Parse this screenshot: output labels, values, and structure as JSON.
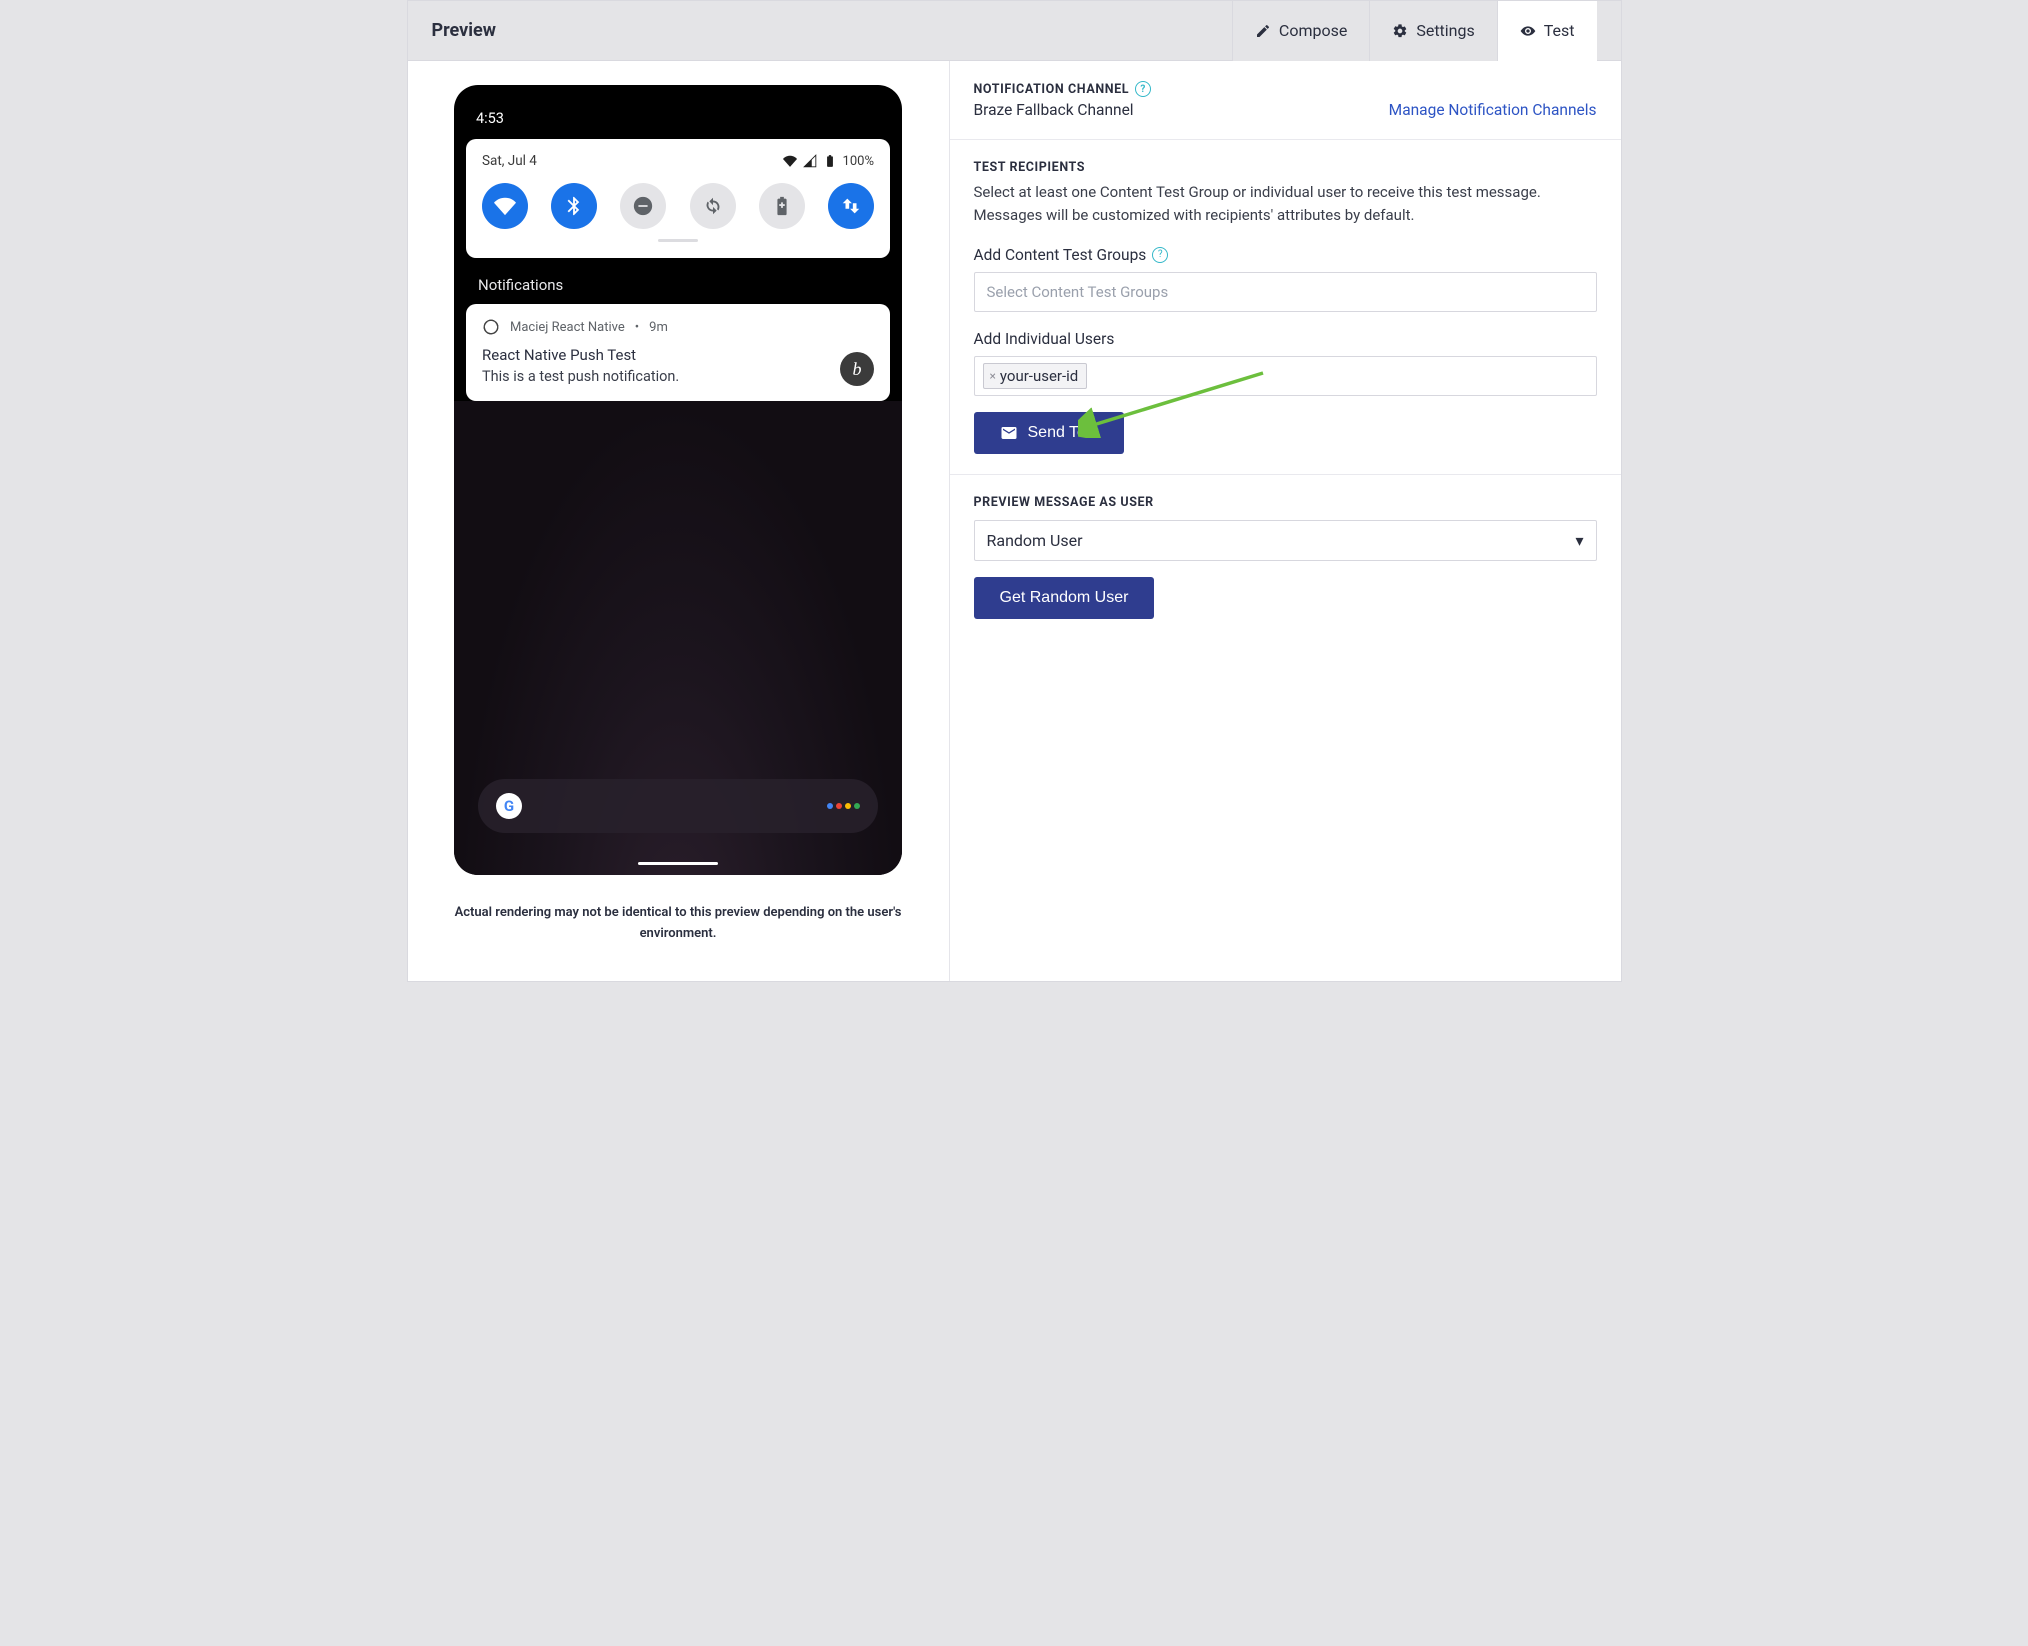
{
  "header": {
    "title": "Preview",
    "tabs": [
      {
        "id": "compose",
        "label": "Compose",
        "icon": "pencil-icon",
        "active": false
      },
      {
        "id": "settings",
        "label": "Settings",
        "icon": "gear-icon",
        "active": false
      },
      {
        "id": "test",
        "label": "Test",
        "icon": "eye-icon",
        "active": true
      }
    ]
  },
  "preview": {
    "phone": {
      "time": "4:53",
      "date": "Sat, Jul 4",
      "battery_pct": "100%",
      "toggles": [
        {
          "name": "wifi",
          "on": true
        },
        {
          "name": "bluetooth",
          "on": true
        },
        {
          "name": "dnd",
          "on": false
        },
        {
          "name": "autorotate",
          "on": false
        },
        {
          "name": "battery-saver",
          "on": false
        },
        {
          "name": "data",
          "on": true
        }
      ],
      "notifications_title": "Notifications",
      "notification": {
        "app_name": "Maciej React Native",
        "time": "9m",
        "title": "React Native Push Test",
        "body": "This is a test push notification.",
        "avatar_letter": "b"
      }
    },
    "caption": "Actual rendering may not be identical to this preview depending on the user's environment."
  },
  "config": {
    "channel": {
      "label": "NOTIFICATION CHANNEL",
      "value": "Braze Fallback Channel",
      "manage_link": "Manage Notification Channels"
    },
    "recipients": {
      "label": "TEST RECIPIENTS",
      "desc": "Select at least one Content Test Group or individual user to receive this test message. Messages will be customized with recipients' attributes by default.",
      "groups_label": "Add Content Test Groups",
      "groups_placeholder": "Select Content Test Groups",
      "users_label": "Add Individual Users",
      "user_chip": "your-user-id",
      "send_button": "Send Test"
    },
    "preview_as": {
      "label": "PREVIEW MESSAGE AS USER",
      "select_value": "Random User",
      "get_button": "Get Random User"
    }
  }
}
